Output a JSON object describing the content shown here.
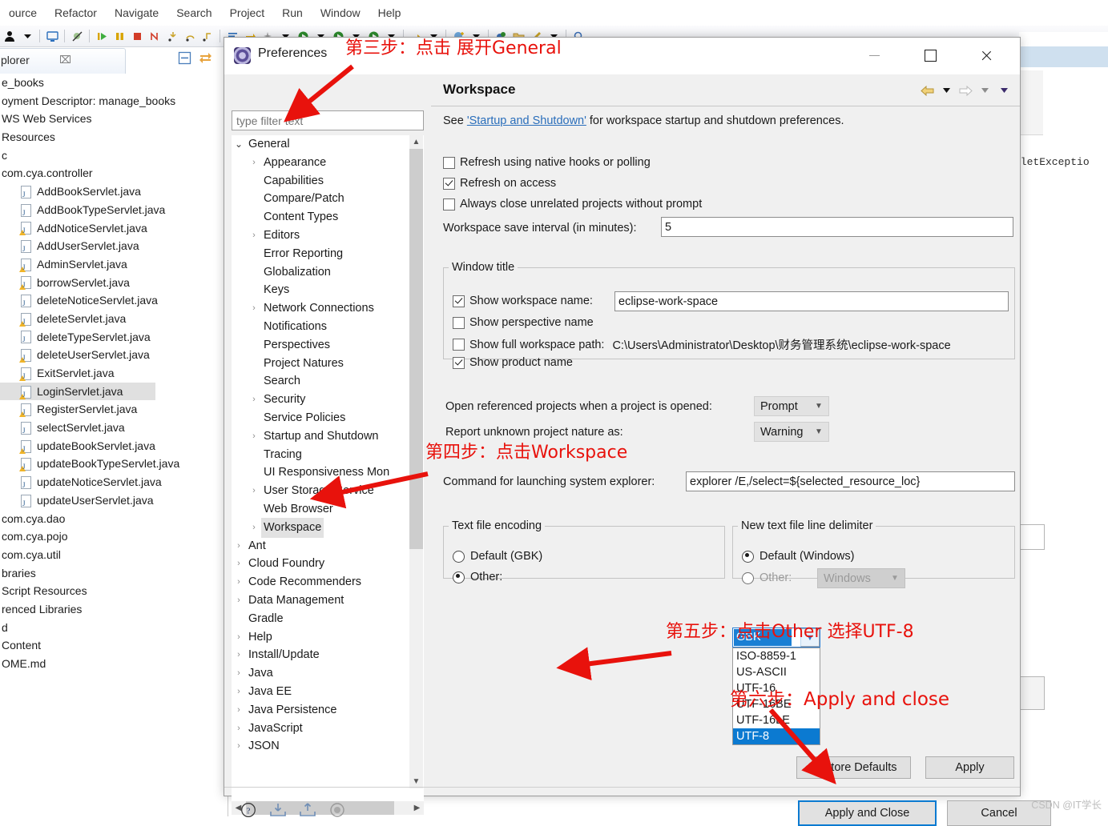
{
  "ide": {
    "menubar": [
      "ource",
      "Refactor",
      "Navigate",
      "Search",
      "Project",
      "Run",
      "Window",
      "Help"
    ],
    "explorer_tab": {
      "label": "plorer",
      "close_glyph": "⌧"
    },
    "tree_items": [
      {
        "label": "e_books",
        "indent": 0,
        "icon": "none"
      },
      {
        "label": "oyment Descriptor: manage_books",
        "indent": 0,
        "icon": "none"
      },
      {
        "label": "WS Web Services",
        "indent": 0,
        "icon": "none"
      },
      {
        "label": "Resources",
        "indent": 0,
        "icon": "none"
      },
      {
        "label": "c",
        "indent": 0,
        "icon": "none"
      },
      {
        "label": "com.cya.controller",
        "indent": 0,
        "icon": "none"
      },
      {
        "label": "AddBookServlet.java",
        "indent": 1,
        "icon": "java"
      },
      {
        "label": "AddBookTypeServlet.java",
        "indent": 1,
        "icon": "java"
      },
      {
        "label": "AddNoticeServlet.java",
        "indent": 1,
        "icon": "java-warn"
      },
      {
        "label": "AddUserServlet.java",
        "indent": 1,
        "icon": "java"
      },
      {
        "label": "AdminServlet.java",
        "indent": 1,
        "icon": "java-warn"
      },
      {
        "label": "borrowServlet.java",
        "indent": 1,
        "icon": "java-warn"
      },
      {
        "label": "deleteNoticeServlet.java",
        "indent": 1,
        "icon": "java"
      },
      {
        "label": "deleteServlet.java",
        "indent": 1,
        "icon": "java-warn"
      },
      {
        "label": "deleteTypeServlet.java",
        "indent": 1,
        "icon": "java"
      },
      {
        "label": "deleteUserServlet.java",
        "indent": 1,
        "icon": "java-warn"
      },
      {
        "label": "ExitServlet.java",
        "indent": 1,
        "icon": "java-warn"
      },
      {
        "label": "LoginServlet.java",
        "indent": 1,
        "icon": "java-warn",
        "selected": true
      },
      {
        "label": "RegisterServlet.java",
        "indent": 1,
        "icon": "java-warn"
      },
      {
        "label": "selectServlet.java",
        "indent": 1,
        "icon": "java"
      },
      {
        "label": "updateBookServlet.java",
        "indent": 1,
        "icon": "java-warn"
      },
      {
        "label": "updateBookTypeServlet.java",
        "indent": 1,
        "icon": "java-warn"
      },
      {
        "label": "updateNoticeServlet.java",
        "indent": 1,
        "icon": "java"
      },
      {
        "label": "updateUserServlet.java",
        "indent": 1,
        "icon": "java"
      },
      {
        "label": "com.cya.dao",
        "indent": 0,
        "icon": "none"
      },
      {
        "label": "com.cya.pojo",
        "indent": 0,
        "icon": "none"
      },
      {
        "label": "com.cya.util",
        "indent": 0,
        "icon": "none"
      },
      {
        "label": "braries",
        "indent": 0,
        "icon": "none"
      },
      {
        "label": "Script Resources",
        "indent": 0,
        "icon": "none"
      },
      {
        "label": "renced Libraries",
        "indent": 0,
        "icon": "none"
      },
      {
        "label": "d",
        "indent": 0,
        "icon": "none"
      },
      {
        "label": "Content",
        "indent": 0,
        "icon": "none"
      },
      {
        "label": "OME.md",
        "indent": 0,
        "icon": "none"
      }
    ],
    "editor_code_fragment": "vletExceptio"
  },
  "dialog": {
    "title": "Preferences",
    "filter": {
      "placeholder": "type filter text",
      "value": ""
    },
    "tree": [
      {
        "label": "General",
        "level": 1,
        "arrow": "down",
        "selected": false
      },
      {
        "label": "Appearance",
        "level": 2,
        "arrow": "right",
        "selected": false
      },
      {
        "label": "Capabilities",
        "level": 2,
        "arrow": "none",
        "selected": false
      },
      {
        "label": "Compare/Patch",
        "level": 2,
        "arrow": "none",
        "selected": false
      },
      {
        "label": "Content Types",
        "level": 2,
        "arrow": "none",
        "selected": false
      },
      {
        "label": "Editors",
        "level": 2,
        "arrow": "right",
        "selected": false
      },
      {
        "label": "Error Reporting",
        "level": 2,
        "arrow": "none",
        "selected": false
      },
      {
        "label": "Globalization",
        "level": 2,
        "arrow": "none",
        "selected": false
      },
      {
        "label": "Keys",
        "level": 2,
        "arrow": "none",
        "selected": false
      },
      {
        "label": "Network Connections",
        "level": 2,
        "arrow": "right",
        "selected": false
      },
      {
        "label": "Notifications",
        "level": 2,
        "arrow": "none",
        "selected": false
      },
      {
        "label": "Perspectives",
        "level": 2,
        "arrow": "none",
        "selected": false
      },
      {
        "label": "Project Natures",
        "level": 2,
        "arrow": "none",
        "selected": false
      },
      {
        "label": "Search",
        "level": 2,
        "arrow": "none",
        "selected": false
      },
      {
        "label": "Security",
        "level": 2,
        "arrow": "right",
        "selected": false
      },
      {
        "label": "Service Policies",
        "level": 2,
        "arrow": "none",
        "selected": false
      },
      {
        "label": "Startup and Shutdown",
        "level": 2,
        "arrow": "right",
        "selected": false
      },
      {
        "label": "Tracing",
        "level": 2,
        "arrow": "none",
        "selected": false
      },
      {
        "label": "UI Responsiveness Mon",
        "level": 2,
        "arrow": "none",
        "selected": false
      },
      {
        "label": "User Storage Service",
        "level": 2,
        "arrow": "right",
        "selected": false
      },
      {
        "label": "Web Browser",
        "level": 2,
        "arrow": "none",
        "selected": false
      },
      {
        "label": "Workspace",
        "level": 2,
        "arrow": "right",
        "selected": true
      },
      {
        "label": "Ant",
        "level": 1,
        "arrow": "right",
        "selected": false
      },
      {
        "label": "Cloud Foundry",
        "level": 1,
        "arrow": "right",
        "selected": false
      },
      {
        "label": "Code Recommenders",
        "level": 1,
        "arrow": "right",
        "selected": false
      },
      {
        "label": "Data Management",
        "level": 1,
        "arrow": "right",
        "selected": false
      },
      {
        "label": "Gradle",
        "level": 1,
        "arrow": "none",
        "selected": false
      },
      {
        "label": "Help",
        "level": 1,
        "arrow": "right",
        "selected": false
      },
      {
        "label": "Install/Update",
        "level": 1,
        "arrow": "right",
        "selected": false
      },
      {
        "label": "Java",
        "level": 1,
        "arrow": "right",
        "selected": false
      },
      {
        "label": "Java EE",
        "level": 1,
        "arrow": "right",
        "selected": false
      },
      {
        "label": "Java Persistence",
        "level": 1,
        "arrow": "right",
        "selected": false
      },
      {
        "label": "JavaScript",
        "level": 1,
        "arrow": "right",
        "selected": false
      },
      {
        "label": "JSON",
        "level": 1,
        "arrow": "right",
        "selected": false
      }
    ]
  },
  "page": {
    "title": "Workspace",
    "see_prefix": "See ",
    "see_link": "'Startup and Shutdown'",
    "see_suffix": " for workspace startup and shutdown preferences.",
    "checkboxes": [
      {
        "label": "Refresh using native hooks or polling",
        "checked": false
      },
      {
        "label": "Refresh on access",
        "checked": true
      },
      {
        "label": "Always close unrelated projects without prompt",
        "checked": false
      }
    ],
    "save_interval": {
      "label": "Workspace save interval (in minutes):",
      "value": "5"
    },
    "window_title_group": {
      "legend": "Window title",
      "show_workspace_name": {
        "label": "Show workspace name:",
        "checked": true,
        "value": "eclipse-work-space"
      },
      "show_perspective_name": {
        "label": "Show perspective name",
        "checked": false
      },
      "show_full_path": {
        "label": "Show full workspace path:",
        "checked": false,
        "value": "C:\\Users\\Administrator\\Desktop\\财务管理系统\\eclipse-work-space"
      },
      "show_product_name": {
        "label": "Show product name",
        "checked": true
      }
    },
    "open_referenced": {
      "label": "Open referenced projects when a project is opened:",
      "value": "Prompt"
    },
    "report_nature": {
      "label": "Report unknown project nature as:",
      "value": "Warning"
    },
    "command_explorer": {
      "label": "Command for launching system explorer:",
      "value": "explorer /E,/select=${selected_resource_loc}"
    },
    "encoding_group": {
      "legend": "Text file encoding",
      "default_option": {
        "label": "Default (GBK)",
        "selected": false
      },
      "other_option": {
        "label": "Other:",
        "selected": true
      },
      "current_value": "GBK",
      "options": [
        "ISO-8859-1",
        "US-ASCII",
        "UTF-16",
        "UTF-16BE",
        "UTF-16LE",
        "UTF-8"
      ],
      "highlighted_option": "UTF-8"
    },
    "delimiter_group": {
      "legend": "New text file line delimiter",
      "default_option": {
        "label": "Default (Windows)",
        "selected": true
      },
      "other_option": {
        "label": "Other:",
        "selected": false,
        "value": "Windows"
      }
    },
    "buttons": {
      "restore_defaults": "Restore Defaults",
      "apply": "Apply",
      "apply_and_close": "Apply and Close",
      "cancel": "Cancel"
    }
  },
  "annotations": [
    {
      "id": "step3",
      "text": "第三步：点击 展开General"
    },
    {
      "id": "step4",
      "text": "第四步：点击Workspace"
    },
    {
      "id": "step5",
      "text": "第五步：点击Other 选择UTF-8"
    },
    {
      "id": "step6",
      "text": "第六步：Apply and close"
    }
  ],
  "watermark": "CSDN @IT学长",
  "colors": {
    "annotation_red": "#e8120c",
    "selection_blue": "#0b7ad1",
    "link_blue": "#2a6ebb",
    "dialog_bg": "#f0f0f0"
  }
}
